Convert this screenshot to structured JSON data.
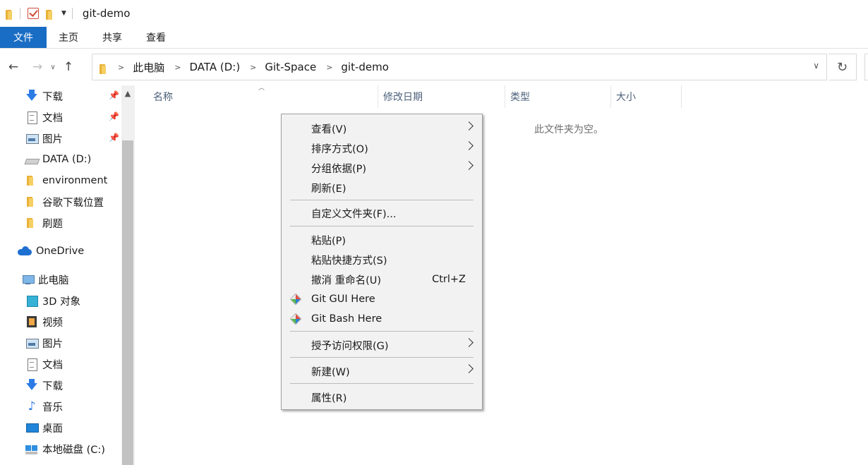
{
  "window": {
    "title": "git-demo"
  },
  "ribbon": {
    "tabs": [
      "文件",
      "主页",
      "共享",
      "查看"
    ]
  },
  "address": {
    "crumbs": [
      "此电脑",
      "DATA (D:)",
      "Git-Space",
      "git-demo"
    ]
  },
  "sidebar": {
    "items": [
      {
        "label": "下载",
        "icon": "download-icon",
        "pinned": true
      },
      {
        "label": "文档",
        "icon": "document-icon",
        "pinned": true
      },
      {
        "label": "图片",
        "icon": "picture-icon",
        "pinned": true
      },
      {
        "label": "DATA (D:)",
        "icon": "drive-icon",
        "pinned": false
      },
      {
        "label": "environment",
        "icon": "folder-icon",
        "pinned": false
      },
      {
        "label": "谷歌下载位置",
        "icon": "folder-icon",
        "pinned": false
      },
      {
        "label": "刷题",
        "icon": "folder-icon",
        "pinned": false
      },
      {
        "label": "OneDrive",
        "icon": "onedrive-icon",
        "pinned": false
      },
      {
        "label": "此电脑",
        "icon": "this-pc-icon",
        "pinned": false
      },
      {
        "label": "3D 对象",
        "icon": "3d-objects-icon",
        "pinned": false
      },
      {
        "label": "视频",
        "icon": "video-icon",
        "pinned": false
      },
      {
        "label": "图片",
        "icon": "picture-icon",
        "pinned": false
      },
      {
        "label": "文档",
        "icon": "document-icon",
        "pinned": false
      },
      {
        "label": "下载",
        "icon": "download-icon",
        "pinned": false
      },
      {
        "label": "音乐",
        "icon": "music-icon",
        "pinned": false
      },
      {
        "label": "桌面",
        "icon": "desktop-icon",
        "pinned": false
      },
      {
        "label": "本地磁盘 (C:)",
        "icon": "local-disk-icon",
        "pinned": false
      }
    ]
  },
  "columns": {
    "name": "名称",
    "modified": "修改日期",
    "type": "类型",
    "size": "大小"
  },
  "content": {
    "empty_message": "此文件夹为空。"
  },
  "context_menu": {
    "view": "查看(V)",
    "sort": "排序方式(O)",
    "group": "分组依据(P)",
    "refresh": "刷新(E)",
    "customize": "自定义文件夹(F)...",
    "paste": "粘贴(P)",
    "paste_shortcut": "粘贴快捷方式(S)",
    "undo": "撤消 重命名(U)",
    "undo_shortcut": "Ctrl+Z",
    "git_gui": "Git GUI Here",
    "git_bash": "Git Bash Here",
    "give_access": "授予访问权限(G)",
    "new": "新建(W)",
    "properties": "属性(R)"
  },
  "colors": {
    "accent": "#1a6dc4",
    "column_header": "#4c607a",
    "folder": "#e9b23a"
  }
}
